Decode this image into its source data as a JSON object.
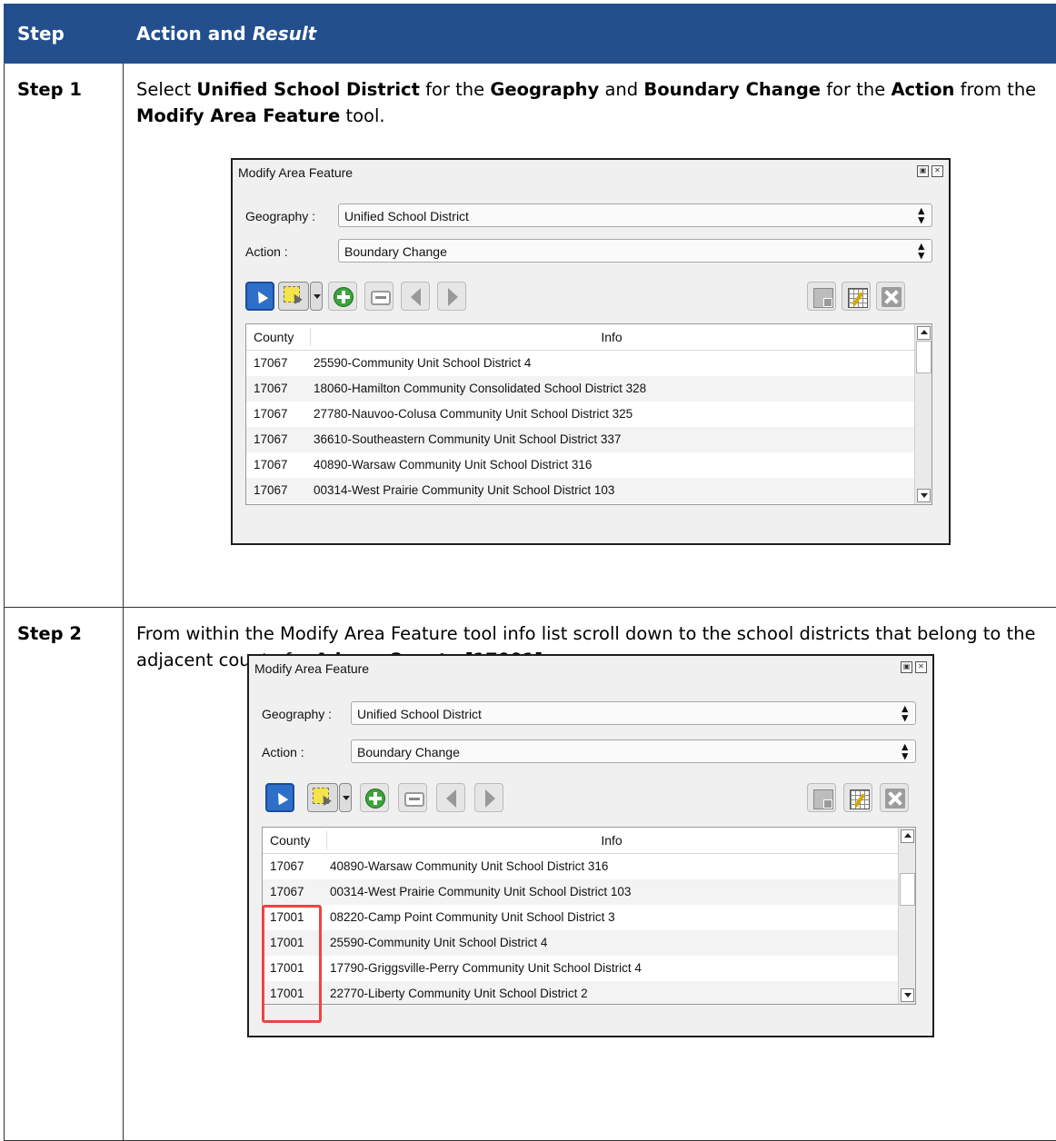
{
  "table": {
    "header_step": "Step",
    "header_action": "Action and ",
    "header_result": "Result"
  },
  "steps": [
    {
      "label": "Step 1",
      "desc": [
        {
          "t": "Select "
        },
        {
          "t": "Unified School District",
          "b": true
        },
        {
          "t": " for the "
        },
        {
          "t": "Geography",
          "b": true
        },
        {
          "t": " and "
        },
        {
          "t": "Boundary Change",
          "b": true
        },
        {
          "t": " for the "
        },
        {
          "t": "Action",
          "b": true
        },
        {
          "t": " from the "
        },
        {
          "t": "Modify Area Feature",
          "b": true
        },
        {
          "t": " tool."
        }
      ]
    },
    {
      "label": "Step 2",
      "desc": [
        {
          "t": "From within the Modify Area Feature tool info list scroll down to the school districts that belong to the adjacent county for "
        },
        {
          "t": "Adams County [17001]",
          "b": true
        },
        {
          "t": "."
        }
      ]
    }
  ],
  "dialogs": [
    {
      "title": "Modify Area Feature",
      "restore_icon": "restore-icon",
      "close_icon": "close-icon",
      "geography_label": "Geography :",
      "geography_value": "Unified School District",
      "action_label": "Action :",
      "action_value": "Boundary Change",
      "col_county": "County",
      "col_info": "Info",
      "rows": [
        {
          "county": "17067",
          "info": "25590-Community Unit School District 4"
        },
        {
          "county": "17067",
          "info": "18060-Hamilton Community Consolidated School District 328"
        },
        {
          "county": "17067",
          "info": "27780-Nauvoo-Colusa Community Unit School District 325"
        },
        {
          "county": "17067",
          "info": "36610-Southeastern Community Unit School District 337"
        },
        {
          "county": "17067",
          "info": "40890-Warsaw Community Unit School District 316"
        },
        {
          "county": "17067",
          "info": "00314-West Prairie Community Unit School District 103"
        }
      ]
    },
    {
      "title": "Modify Area Feature",
      "restore_icon": "restore-icon",
      "close_icon": "close-icon",
      "geography_label": "Geography :",
      "geography_value": "Unified School District",
      "action_label": "Action :",
      "action_value": "Boundary Change",
      "col_county": "County",
      "col_info": "Info",
      "rows": [
        {
          "county": "17067",
          "info": "40890-Warsaw Community Unit School District 316"
        },
        {
          "county": "17067",
          "info": "00314-West Prairie Community Unit School District 103"
        },
        {
          "county": "17001",
          "info": "08220-Camp Point Community Unit School District 3"
        },
        {
          "county": "17001",
          "info": "25590-Community Unit School District 4"
        },
        {
          "county": "17001",
          "info": "17790-Griggsville-Perry Community Unit School District 4"
        },
        {
          "county": "17001",
          "info": "22770-Liberty Community Unit School District 2"
        }
      ]
    }
  ],
  "colors": {
    "header_bg": "#234f8d",
    "highlight": "#e44444"
  }
}
